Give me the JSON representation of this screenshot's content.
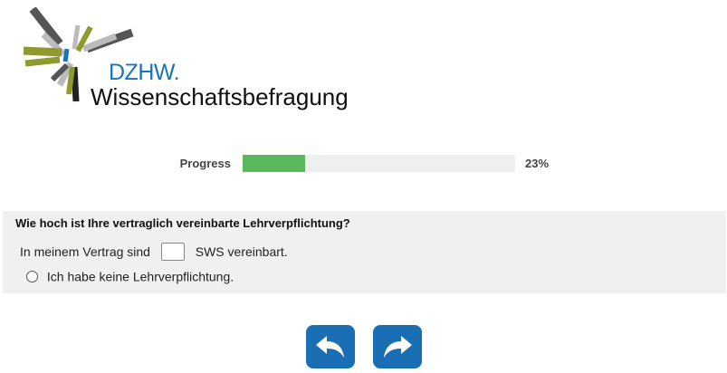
{
  "logo": {
    "brand": "DZHW.",
    "subtitle": "Wissenschaftsbefragung",
    "colors": {
      "blue": "#1a74b8",
      "olive": "#8e9a2b",
      "dark_gray": "#555555",
      "light_gray": "#bbbbbb"
    }
  },
  "progress": {
    "label": "Progress",
    "percent_text": "23%",
    "value": 0.23,
    "fill_color": "#5cb85c"
  },
  "question": {
    "text": "Wie hoch ist Ihre vertraglich vereinbarte Lehrverpflichtung?",
    "prefix": "In meinem Vertrag sind",
    "input_value": "",
    "suffix": "SWS vereinbart.",
    "option_none": "Ich habe keine Lehrverpflichtung."
  },
  "nav": {
    "back_icon": "undo-arrow-icon",
    "next_icon": "redo-arrow-icon",
    "button_color": "#1a6fb4"
  }
}
